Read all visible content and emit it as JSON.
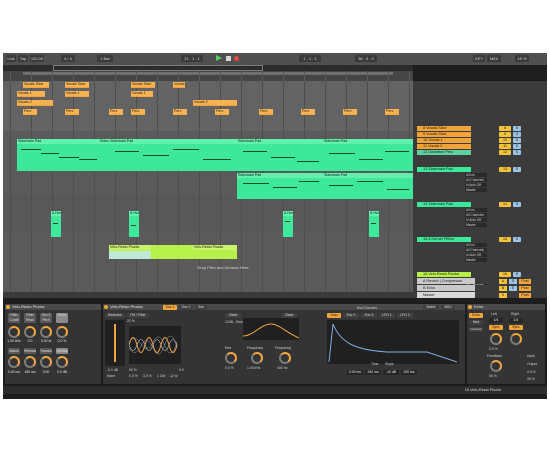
{
  "transport": {
    "link": "Link",
    "tap": "Tap",
    "tempo": "120.00",
    "time_sig": "4 / 4",
    "bar": "1 Bar",
    "position": "21 . 1 . 1",
    "loop_start": "1 . 1 . 1",
    "loop_length": "36 . 0 . 0",
    "key": "KEY",
    "midi": "MIDI",
    "cpu": "15 %"
  },
  "clips": {
    "vocals_slice_1": "Vocals Slice",
    "vocals_slice_2": "Vocals Slice",
    "vocals_slice_3": "Vocals Slice",
    "vocals_slice_4": "Vocals Slice",
    "vocals_1_a": "Vocals 1",
    "vocals_1_b": "Vocals 1",
    "vocals_2": "Vocals 2",
    "vocals_2_b": "Vocals 2",
    "perc": "Perc",
    "sidechain_pad_1": "Sidechain Pad",
    "sidechain_pad_2": "Sidechain Pad",
    "sidechain_pad_3": "Sidechain Pad",
    "sidechain_pad_4": "Sidechain Pad",
    "sidechain_pad_5": "Sidechain Pad",
    "sidechain_pad_6": "Sidechain Pad",
    "sidechain_pad_7": "Sidechain Pad",
    "sidechain_pad_8": "Sidechain Pad",
    "hornet": "A Hor",
    "velo_plucks_1": "Velo-Resto Plucks",
    "velo_plucks_2": "Velo-Resto Plucks"
  },
  "drop_hint": "Drop Files and Devices Here",
  "tracks": [
    {
      "name": "8 Vocals Slice",
      "color": "#f4a23a",
      "num": "8",
      "s": "S"
    },
    {
      "name": "9 Vocals Slice",
      "color": "#f4a23a",
      "num": "9",
      "s": "S"
    },
    {
      "name": "10 Vocals 1",
      "color": "#f4a23a",
      "num": "10",
      "s": "S"
    },
    {
      "name": "11 Vocals 2",
      "color": "#f4a23a",
      "num": "11",
      "s": "S"
    },
    {
      "name": "12 Distortion Perc",
      "color": "#5fd0a0",
      "num": "12",
      "s": "S"
    },
    {
      "name": "13 Sidechain Pad",
      "color": "#3ee89a",
      "num": "13",
      "s": "S",
      "input": "All Ins",
      "channel": "All Channels",
      "monitor": "In  Auto  Off",
      "output": "Master"
    },
    {
      "name": "14 Sidechain Pad",
      "color": "#3ee89a",
      "num": "14",
      "s": "S",
      "input": "All Ins",
      "channel": "All Channels",
      "monitor": "In  Auto  Off",
      "output": "Master"
    },
    {
      "name": "15 A Hornet Pitline",
      "color": "#3ee89a",
      "num": "15",
      "s": "S",
      "input": "All Ins",
      "channel": "All Channels",
      "monitor": "In  Auto  Off",
      "output": "Master"
    },
    {
      "name": "16 Velo-Resto Plucks",
      "color": "#b7f04a",
      "num": "16",
      "s": "S",
      "input": "All Ins",
      "channel": "All Channels",
      "monitor": "In  Auto  Off",
      "output": "Master"
    }
  ],
  "returns": [
    {
      "name": "A Reverb | Compressor",
      "letter": "A",
      "s": "S",
      "post": "Post"
    },
    {
      "name": "B Echo",
      "letter": "B",
      "s": "S",
      "post": "Post"
    },
    {
      "name": "Master",
      "letter": "0",
      "s": "",
      "post": "Post"
    }
  ],
  "devices": {
    "rack": {
      "title": "Velo-Resto Plucks",
      "macros": [
        "Filter Cutoff",
        "Filter Reso",
        "Osc 2 Pitch",
        "Echo"
      ],
      "knob_values": [
        "1.90 kHz",
        "0.0",
        "0.00 st",
        "0.0 %"
      ],
      "macros2": [
        "Attack",
        "Release",
        "Transient",
        "Volume"
      ],
      "knob_values2": [
        "0.00 ms",
        "180 ms",
        "0.00",
        "0.0 dB"
      ]
    },
    "wavetable": {
      "title": "Velo-Resto Plucks",
      "tabs": [
        "Osc",
        "Osc 1",
        "Osc 2",
        "Sub"
      ],
      "osc_label": "Distortion",
      "osc_mode": "FM / Filter",
      "pos": "22 %",
      "pitch": "-0.1 dB",
      "detune": "0.0",
      "wave_mode": "None",
      "readouts": [
        "50 %",
        "0.0 %",
        "3.0 %",
        "1 Oct",
        "-12 st",
        "0.0"
      ],
      "filter_tabs": [
        "Clean",
        "Clean"
      ],
      "filter_mode": "12dB - Serial",
      "res_label": "Res",
      "freq_label": "Frequency",
      "freq_val": "1.00 kHz",
      "freq2_label": "Frequency",
      "freq2_val": "400 Hz",
      "res_val": "0.0 %",
      "mod_tabs": [
        "Amp",
        "Env 2",
        "Env 3",
        "LFO 1",
        "LFO 2"
      ],
      "mod_matrix": "Mod Sources",
      "matrix_tab": "Matrix",
      "midi_tab": "MIDI",
      "time_label": "Time",
      "slope_label": "Slope",
      "env_vals": [
        "0.00 ms",
        "342 ms",
        "-10 dB",
        "200 ms"
      ]
    },
    "echo": {
      "title": "Echo",
      "tabs": [
        "Echo",
        "Mod",
        "Character"
      ],
      "sync_label": "Sync",
      "left_label": "Left",
      "right_label": "Right",
      "vals": [
        "1/4",
        "1/4",
        "0.0 %",
        "55 %",
        "0.0 %",
        "35 %"
      ],
      "feedback_label": "Feedback",
      "input_label": "Input",
      "output_label": "Output",
      "dry_wet": "Dry/Wet"
    }
  },
  "status": "16-Velo-Resto Plucks"
}
